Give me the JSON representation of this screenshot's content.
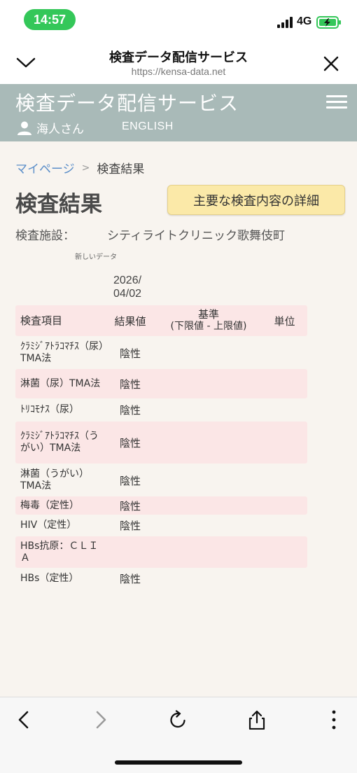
{
  "status_bar": {
    "time": "14:57",
    "network": "4G"
  },
  "browser": {
    "title": "検査データ配信サービス",
    "url": "https://kensa-data.net"
  },
  "header": {
    "site_title": "検査データ配信サービス",
    "user_name": "海人さん",
    "english_link": "ENGLISH"
  },
  "breadcrumb": {
    "home": "マイページ",
    "separator": ">",
    "current": "検査結果"
  },
  "page": {
    "title": "検査結果",
    "detail_button": "主要な検査内容の詳細",
    "facility_label": "検査施設：",
    "facility_name": "シティライトクリニック歌舞伎町",
    "new_data_label": "新しいデータ",
    "date_line1": "2026/",
    "date_line2": "04/02"
  },
  "table": {
    "headers": {
      "item": "検査項目",
      "value": "結果値",
      "standard_line1": "基準",
      "standard_line2": "(下限値 - 上限値)",
      "unit": "単位"
    },
    "rows": [
      {
        "item": "ｸﾗﾐｼﾞｱﾄﾗｺﾏﾁｽ（尿）TMA法",
        "value": "陰性",
        "standard": "",
        "unit": ""
      },
      {
        "item": "淋菌（尿）TMA法",
        "value": "陰性",
        "standard": "",
        "unit": ""
      },
      {
        "item": "ﾄﾘｺﾓﾅｽ（尿）",
        "value": "陰性",
        "standard": "",
        "unit": ""
      },
      {
        "item": "ｸﾗﾐｼﾞｱﾄﾗｺﾏﾁｽ（うがい）TMA法",
        "value": "陰性",
        "standard": "",
        "unit": ""
      },
      {
        "item": "淋菌（うがい）TMA法",
        "value": "陰性",
        "standard": "",
        "unit": ""
      },
      {
        "item": "梅毒（定性）",
        "value": "陰性",
        "standard": "",
        "unit": ""
      },
      {
        "item": "HIV（定性）",
        "value": "陰性",
        "standard": "",
        "unit": ""
      },
      {
        "item": "HBs抗原：ＣＬＩＡ",
        "value": "",
        "standard": "",
        "unit": ""
      },
      {
        "item": "HBs（定性）",
        "value": "陰性",
        "standard": "",
        "unit": ""
      }
    ]
  },
  "colors": {
    "header_bg": "#a9bab8",
    "page_bg": "#f8f4ef",
    "row_pink": "#fbe6e6",
    "button_bg": "#fbe9a8",
    "link": "#5b8ec9",
    "time_pill": "#34c759"
  },
  "icons": {
    "status": [
      "signal-bars-icon",
      "battery-charging-icon"
    ],
    "browser_top": [
      "chevron-down-icon",
      "close-icon"
    ],
    "header": [
      "user-icon",
      "hamburger-menu-icon"
    ],
    "browser_bottom": [
      "back-icon",
      "forward-icon",
      "reload-icon",
      "share-icon",
      "more-icon"
    ]
  }
}
